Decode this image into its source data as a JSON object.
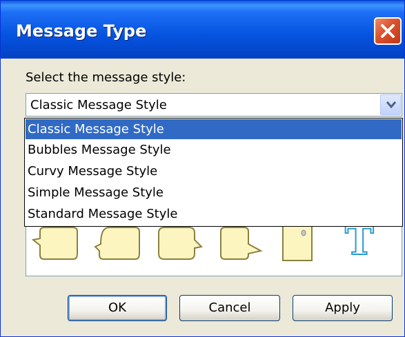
{
  "window": {
    "title": "Message Type"
  },
  "prompt_label": "Select the message style:",
  "combo": {
    "selected": "Classic Message Style"
  },
  "options": [
    "Classic Message Style",
    "Bubbles Message Style",
    "Curvy Message Style",
    "Simple Message Style",
    "Standard Message Style"
  ],
  "selected_index": 0,
  "preview_icons": [
    "classic-bubble-icon",
    "bubbles-bubble-icon",
    "curvy-bubble-icon",
    "simple-bubble-icon",
    "standard-note-icon",
    "text-style-icon"
  ],
  "preview_text_glyph": "T",
  "buttons": {
    "ok": "OK",
    "cancel": "Cancel",
    "apply": "Apply"
  },
  "colors": {
    "title_bar": "#0553e0",
    "selection": "#316ac5",
    "close": "#d9522c"
  }
}
